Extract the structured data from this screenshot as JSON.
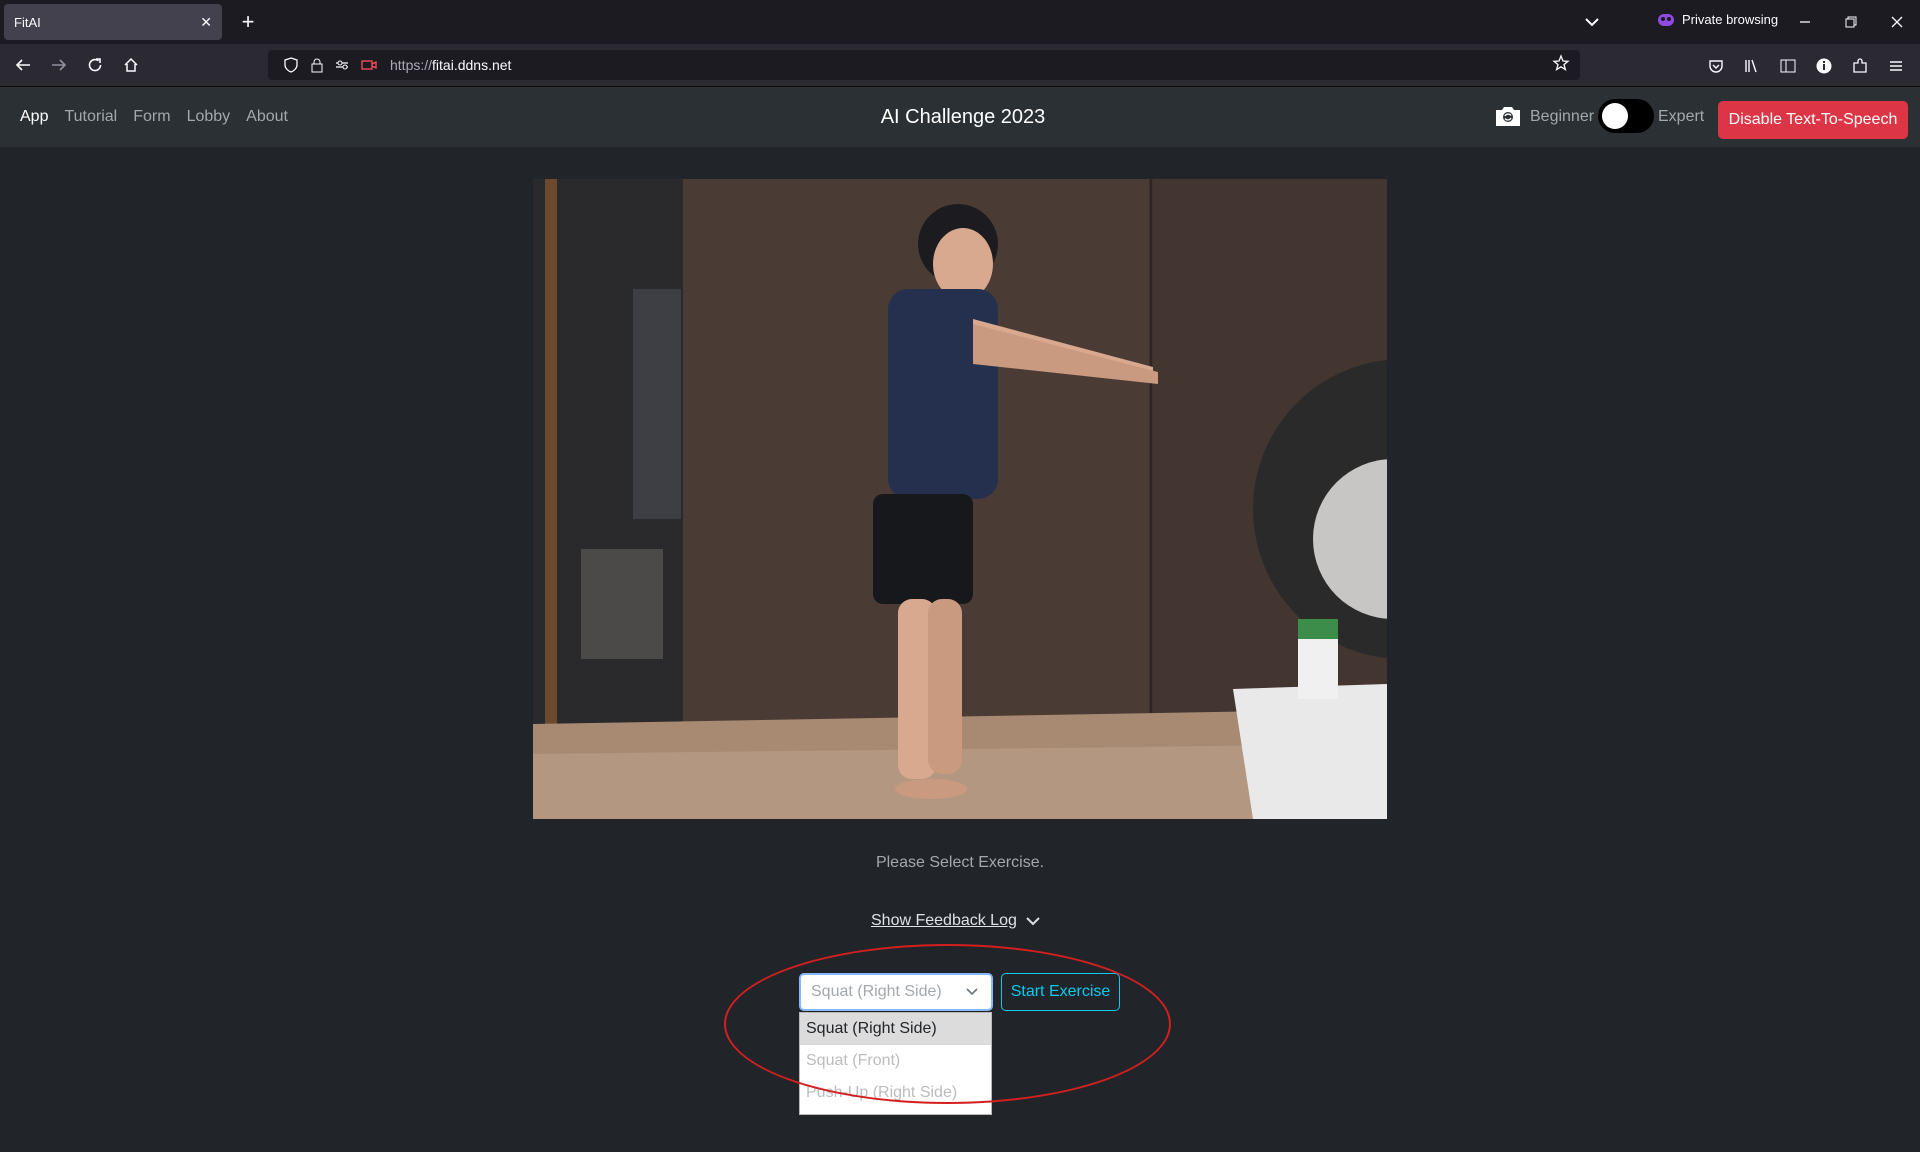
{
  "browser": {
    "tab_title": "FitAI",
    "new_tab_symbol": "+",
    "private_label": "Private browsing",
    "url_scheme": "https://",
    "url_host": "fitai.ddns.net"
  },
  "app": {
    "nav_links": [
      "App",
      "Tutorial",
      "Form",
      "Lobby",
      "About"
    ],
    "active_link": "App",
    "brand": "AI Challenge 2023",
    "level_left": "Beginner",
    "level_right": "Expert",
    "tts_button": "Disable Text-To-Speech"
  },
  "main": {
    "status_text": "Please Select Exercise.",
    "feedback_toggle": "Show Feedback Log",
    "select_value": "Squat (Right Side)",
    "start_button": "Start Exercise",
    "options": [
      "Squat (Right Side)",
      "Squat (Front)",
      "Push-Up (Right Side)"
    ]
  },
  "colors": {
    "page_bg": "#212529",
    "nav_bg": "#2b3035",
    "danger": "#dc3545",
    "info": "#0dcaf0",
    "annotation": "#d41f1f"
  },
  "icons": [
    "back-arrow-icon",
    "forward-arrow-icon",
    "reload-icon",
    "home-icon",
    "shield-icon",
    "lock-icon",
    "camera-icon",
    "star-icon",
    "chevron-down-icon"
  ]
}
